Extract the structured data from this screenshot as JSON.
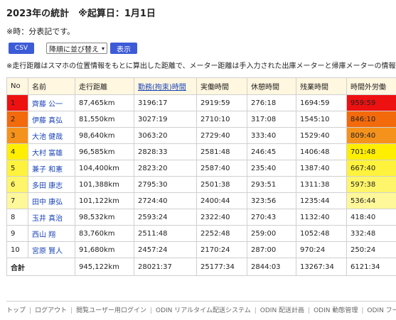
{
  "page": {
    "title": "2023年の統計　※起算日：1月1日",
    "time_note": "※時：分表記です。",
    "csv_label": "CSV",
    "sort_select": "降順に並び替え",
    "show_label": "表示",
    "distance_note": "※走行距離はスマホの位置情報をもとに算出した距離で、メーター距離は手入力された出庫メーターと帰庫メーターの情報を"
  },
  "table": {
    "headers": [
      "No",
      "名前",
      "走行距離",
      "勤務(拘束)時間",
      "実働時間",
      "休憩時間",
      "残業時間",
      "時間外労働"
    ],
    "rows": [
      {
        "no": "1",
        "name": "齊藤 公一",
        "distance": "87,465km",
        "work": "3196:17",
        "actual": "2919:59",
        "rest": "276:18",
        "overtime": "1694:59",
        "extra": "959:59",
        "no_color": "#ee1111",
        "extra_color": "#ee1111"
      },
      {
        "no": "2",
        "name": "伊藤 真弘",
        "distance": "81,550km",
        "work": "3027:19",
        "actual": "2710:10",
        "rest": "317:08",
        "overtime": "1545:10",
        "extra": "846:10",
        "no_color": "#f26a0c",
        "extra_color": "#f26a0c"
      },
      {
        "no": "3",
        "name": "大池 健哉",
        "distance": "98,640km",
        "work": "3063:20",
        "actual": "2729:40",
        "rest": "333:40",
        "overtime": "1529:40",
        "extra": "809:40",
        "no_color": "#f5921c",
        "extra_color": "#f5921c"
      },
      {
        "no": "4",
        "name": "大村 富雄",
        "distance": "96,585km",
        "work": "2828:33",
        "actual": "2581:48",
        "rest": "246:45",
        "overtime": "1406:48",
        "extra": "701:48",
        "no_color": "#ffee00",
        "extra_color": "#ffee00"
      },
      {
        "no": "5",
        "name": "兼子 和憲",
        "distance": "104,400km",
        "work": "2823:20",
        "actual": "2587:40",
        "rest": "235:40",
        "overtime": "1387:40",
        "extra": "667:40",
        "no_color": "#fff23c",
        "extra_color": "#fff23c"
      },
      {
        "no": "6",
        "name": "多田 康志",
        "distance": "101,388km",
        "work": "2795:30",
        "actual": "2501:38",
        "rest": "293:51",
        "overtime": "1311:38",
        "extra": "597:38",
        "no_color": "#fff56a",
        "extra_color": "#fff56a"
      },
      {
        "no": "7",
        "name": "田中 康弘",
        "distance": "101,122km",
        "work": "2724:40",
        "actual": "2400:44",
        "rest": "323:56",
        "overtime": "1235:44",
        "extra": "536:44",
        "no_color": "#fff89a",
        "extra_color": "#fff89a"
      },
      {
        "no": "8",
        "name": "玉井 真治",
        "distance": "98,532km",
        "work": "2593:24",
        "actual": "2322:40",
        "rest": "270:43",
        "overtime": "1132:40",
        "extra": "418:40",
        "no_color": "#ffffff",
        "extra_color": "#ffffff"
      },
      {
        "no": "9",
        "name": "西山 翔",
        "distance": "83,760km",
        "work": "2511:48",
        "actual": "2252:48",
        "rest": "259:00",
        "overtime": "1052:48",
        "extra": "332:48",
        "no_color": "#ffffff",
        "extra_color": "#ffffff"
      },
      {
        "no": "10",
        "name": "宮原 賢人",
        "distance": "91,680km",
        "work": "2457:24",
        "actual": "2170:24",
        "rest": "287:00",
        "overtime": "970:24",
        "extra": "250:24",
        "no_color": "#ffffff",
        "extra_color": "#ffffff"
      }
    ],
    "total": {
      "label": "合計",
      "distance": "945,122km",
      "work": "28021:37",
      "actual": "25177:34",
      "rest": "2844:03",
      "overtime": "13267:34",
      "extra": "6121:34"
    }
  },
  "footer": {
    "links": [
      "トップ",
      "ログアウト",
      "閲覧ユーザー用ログイン",
      "ODIN リアルタイム配送システム",
      "ODIN 配送計画",
      "ODIN 動態管理",
      "ODIN フードデリバ"
    ]
  }
}
